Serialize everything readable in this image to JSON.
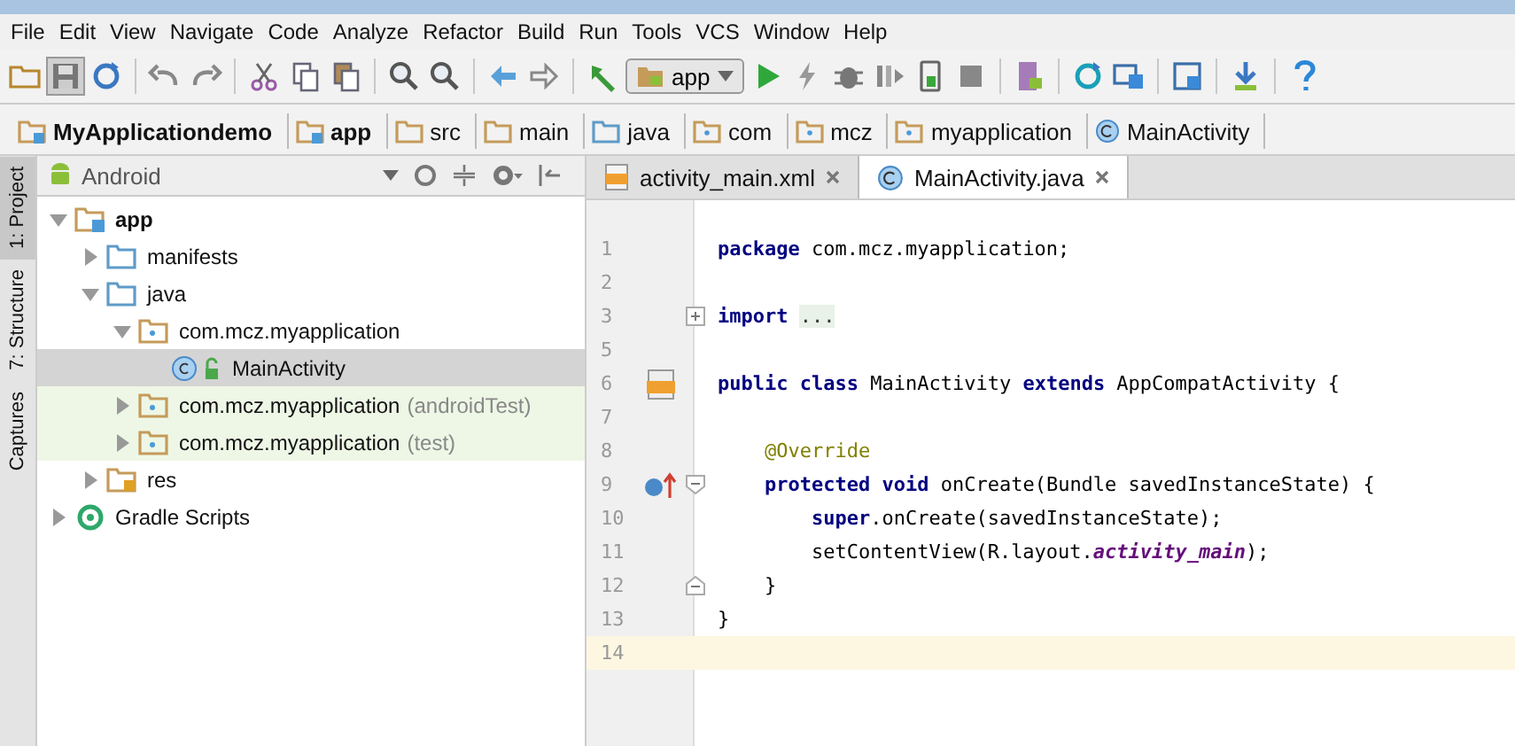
{
  "menu": [
    "File",
    "Edit",
    "View",
    "Navigate",
    "Code",
    "Analyze",
    "Refactor",
    "Build",
    "Run",
    "Tools",
    "VCS",
    "Window",
    "Help"
  ],
  "toolbar": {
    "run_config": "app"
  },
  "breadcrumb": [
    {
      "label": "MyApplicationdemo",
      "kind": "module"
    },
    {
      "label": "app",
      "kind": "module"
    },
    {
      "label": "src",
      "kind": "folder"
    },
    {
      "label": "main",
      "kind": "folder"
    },
    {
      "label": "java",
      "kind": "source"
    },
    {
      "label": "com",
      "kind": "package"
    },
    {
      "label": "mcz",
      "kind": "package"
    },
    {
      "label": "myapplication",
      "kind": "package"
    },
    {
      "label": "MainActivity",
      "kind": "class"
    }
  ],
  "side_tabs": [
    {
      "label": "1: Project",
      "selected": true
    },
    {
      "label": "7: Structure",
      "selected": false
    },
    {
      "label": "Captures",
      "selected": false
    }
  ],
  "project": {
    "view": "Android",
    "tree": [
      {
        "label": "app",
        "kind": "module",
        "expanded": true,
        "selected": false,
        "highlighted": false,
        "children": [
          {
            "label": "manifests",
            "kind": "folder",
            "expanded": false,
            "selected": false,
            "highlighted": false
          },
          {
            "label": "java",
            "kind": "folder",
            "expanded": true,
            "selected": false,
            "highlighted": false,
            "children": [
              {
                "label": "com.mcz.myapplication",
                "kind": "package",
                "expanded": true,
                "selected": false,
                "highlighted": false,
                "children": [
                  {
                    "label": "MainActivity",
                    "kind": "class",
                    "selected": true,
                    "highlighted": false
                  }
                ]
              },
              {
                "label": "com.mcz.myapplication",
                "qualifier": "(androidTest)",
                "kind": "package",
                "expanded": false,
                "selected": false,
                "highlighted": true
              },
              {
                "label": "com.mcz.myapplication",
                "qualifier": "(test)",
                "kind": "package",
                "expanded": false,
                "selected": false,
                "highlighted": true
              }
            ]
          },
          {
            "label": "res",
            "kind": "res",
            "expanded": false,
            "selected": false,
            "highlighted": false
          }
        ]
      },
      {
        "label": "Gradle Scripts",
        "kind": "gradle",
        "expanded": false,
        "selected": false,
        "highlighted": false
      }
    ]
  },
  "editor_tabs": [
    {
      "label": "activity_main.xml",
      "kind": "xml",
      "selected": false
    },
    {
      "label": "MainActivity.java",
      "kind": "class",
      "selected": true
    }
  ],
  "code": [
    {
      "number": "1",
      "tokens": [
        {
          "kind": "keyword",
          "text": "package"
        },
        {
          "kind": "plain",
          "text": " com.mcz.myapplication;"
        }
      ]
    },
    {
      "number": "2"
    },
    {
      "number": "3",
      "fold": {
        "kind": "plus"
      },
      "tokens": [
        {
          "kind": "keyword",
          "text": "import "
        },
        {
          "kind": "folded",
          "text": "..."
        }
      ]
    },
    {
      "number": "5"
    },
    {
      "number": "6",
      "marker": {
        "kind": "layout"
      },
      "tokens": [
        {
          "kind": "keyword",
          "text": "public class"
        },
        {
          "kind": "plain",
          "text": " MainActivity "
        },
        {
          "kind": "keyword",
          "text": "extends"
        },
        {
          "kind": "plain",
          "text": " AppCompatActivity {"
        }
      ]
    },
    {
      "number": "7"
    },
    {
      "number": "8",
      "tokens": [
        {
          "kind": "annotation",
          "text": "    @Override"
        }
      ]
    },
    {
      "number": "9",
      "marker": {
        "kind": "override"
      },
      "fold": {
        "kind": "minus"
      },
      "tokens": [
        {
          "kind": "keyword",
          "text": "    protected void"
        },
        {
          "kind": "plain",
          "text": " onCreate(Bundle savedInstanceState) {"
        }
      ]
    },
    {
      "number": "10",
      "tokens": [
        {
          "kind": "keyword",
          "text": "        super"
        },
        {
          "kind": "plain",
          "text": ".onCreate(savedInstanceState);"
        }
      ]
    },
    {
      "number": "11",
      "tokens": [
        {
          "kind": "plain",
          "text": "        setContentView(R.layout."
        },
        {
          "kind": "field",
          "text": "activity_main"
        },
        {
          "kind": "plain",
          "text": ");"
        }
      ]
    },
    {
      "number": "12",
      "fold": {
        "kind": "end"
      },
      "tokens": [
        {
          "kind": "plain",
          "text": "    }"
        }
      ]
    },
    {
      "number": "13",
      "tokens": [
        {
          "kind": "plain",
          "text": "}"
        }
      ]
    },
    {
      "number": "14",
      "current": true
    }
  ]
}
